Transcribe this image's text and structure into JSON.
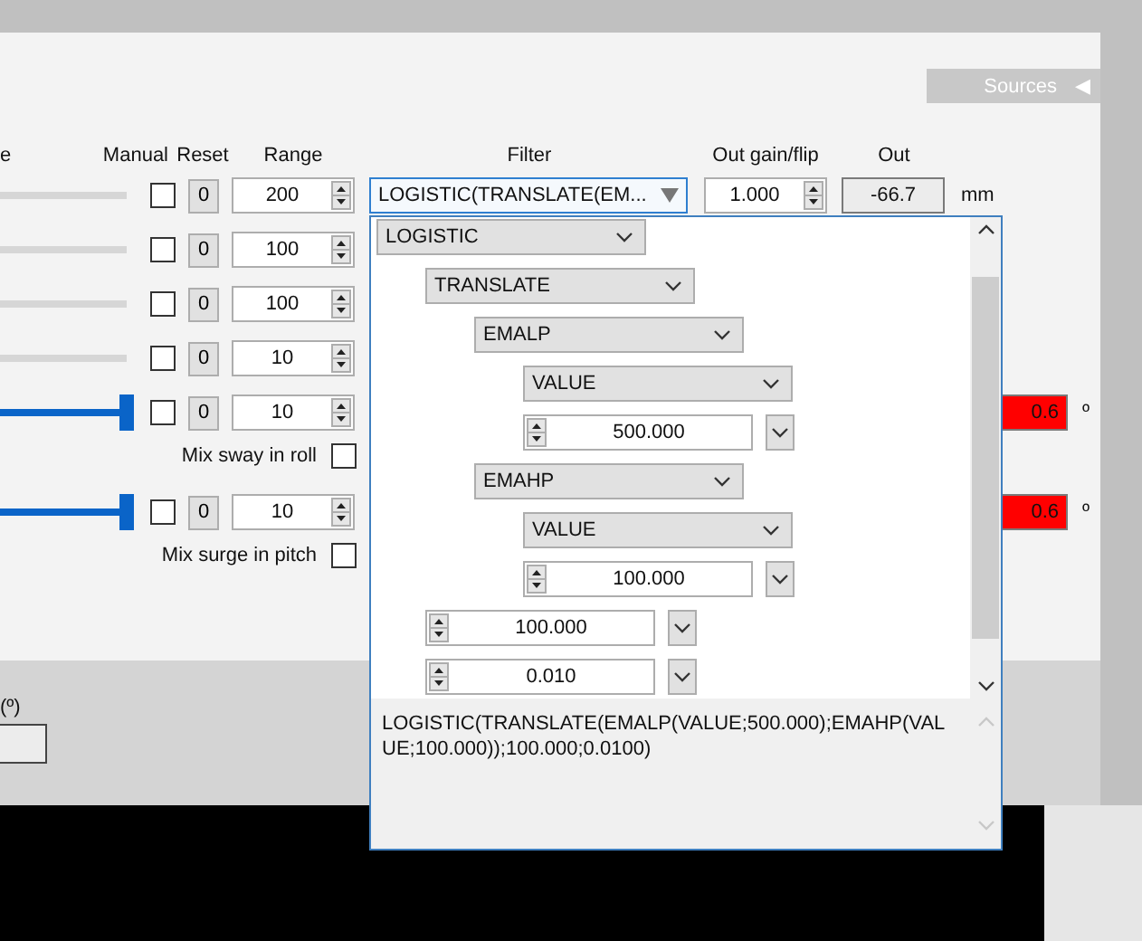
{
  "sources_tab": {
    "label": "Sources",
    "arrow": "◀"
  },
  "columns": [
    "e",
    "Manual",
    "Reset",
    "Range",
    "Filter",
    "Out gain/flip",
    "Out"
  ],
  "rows": [
    {
      "kind": "axis",
      "level": 0,
      "manual": false,
      "reset": "0",
      "range": "200",
      "filter": "LOGISTIC(TRANSLATE(EM...",
      "out_gain": "1.000",
      "out": "-66.7",
      "unit": "mm"
    },
    {
      "kind": "axis",
      "level": 0,
      "manual": false,
      "reset": "0",
      "range": "100"
    },
    {
      "kind": "axis",
      "level": 0,
      "manual": false,
      "reset": "0",
      "range": "100"
    },
    {
      "kind": "axis",
      "level": 0,
      "manual": false,
      "reset": "0",
      "range": "10"
    },
    {
      "kind": "axis",
      "level": 1,
      "manual": false,
      "reset": "0",
      "range": "10",
      "angle_out": "0.6",
      "alarm": true,
      "unit": "º"
    },
    {
      "kind": "mix",
      "label": "Mix sway in roll",
      "checked": false
    },
    {
      "kind": "axis",
      "level": 1,
      "manual": false,
      "reset": "0",
      "range": "10",
      "angle_out": "0.6",
      "alarm": true,
      "unit": "º"
    },
    {
      "kind": "mix",
      "label": "Mix surge in pitch",
      "checked": false
    }
  ],
  "lower_panel": {
    "label": "(º)"
  },
  "filter_popup": {
    "tree": [
      {
        "kind": "combo",
        "label": "LOGISTIC",
        "children": [
          {
            "kind": "combo",
            "label": "TRANSLATE",
            "children": [
              {
                "kind": "combo",
                "label": "EMALP",
                "children": [
                  {
                    "kind": "combo",
                    "label": "VALUE"
                  },
                  {
                    "kind": "number",
                    "value": "500.000"
                  }
                ]
              },
              {
                "kind": "combo",
                "label": "EMAHP",
                "children": [
                  {
                    "kind": "combo",
                    "label": "VALUE"
                  },
                  {
                    "kind": "number",
                    "value": "100.000"
                  }
                ]
              }
            ]
          },
          {
            "kind": "number",
            "value": "100.000"
          },
          {
            "kind": "number",
            "value": "0.010"
          }
        ]
      }
    ],
    "expression": "LOGISTIC(TRANSLATE(EMALP(VALUE;500.000);EMAHP(VALUE;100.000));100.000;0.0100)"
  }
}
